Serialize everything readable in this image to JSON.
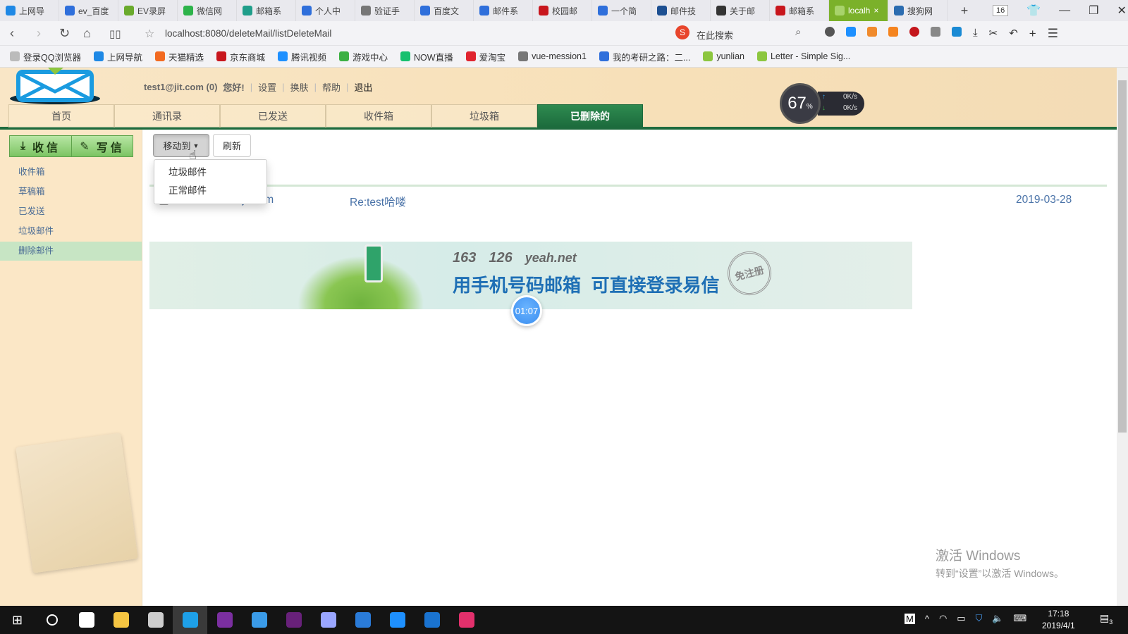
{
  "browser": {
    "tabs": [
      {
        "label": "上网导",
        "color": "#1e88e5"
      },
      {
        "label": "ev_百度",
        "color": "#2f6fdb"
      },
      {
        "label": "EV录屏",
        "color": "#6aaa2c"
      },
      {
        "label": "微信网",
        "color": "#2db34a"
      },
      {
        "label": "邮箱系",
        "color": "#1f9e8a"
      },
      {
        "label": "个人中",
        "color": "#2f6fdb"
      },
      {
        "label": "验证手",
        "color": "#777777"
      },
      {
        "label": "百度文",
        "color": "#2f6fdb"
      },
      {
        "label": "邮件系",
        "color": "#2f6fdb"
      },
      {
        "label": "校园邮",
        "color": "#c8161d"
      },
      {
        "label": "一个简",
        "color": "#2f6fdb"
      },
      {
        "label": "邮件技",
        "color": "#1d4f91"
      },
      {
        "label": "关于邮",
        "color": "#333333"
      },
      {
        "label": "邮箱系",
        "color": "#c8161d"
      },
      {
        "label": "localh",
        "color": "#a8d36b",
        "active": true
      },
      {
        "label": "搜狗网",
        "color": "#2b6cb0"
      }
    ],
    "new_tab": "+",
    "tab_count": "16",
    "url": "localhost:8080/deleteMail/listDeleteMail",
    "search_placeholder": "在此搜索",
    "bookmarks": [
      "登录QQ浏览器",
      "上网导航",
      "天猫精选",
      "京东商城",
      "腾讯视频",
      "游戏中心",
      "NOW直播",
      "爱淘宝",
      "vue-mession1",
      "我的考研之路：二...",
      "yunlian",
      "Letter - Simple Sig..."
    ]
  },
  "header": {
    "user": "test1@jit.com (0)",
    "greeting": "您好!",
    "links": [
      "设置",
      "换肤",
      "帮助",
      "退出"
    ],
    "nav": [
      "首页",
      "通讯录",
      "已发送",
      "收件箱",
      "垃圾箱",
      "已删除的"
    ],
    "active_nav": 5
  },
  "speed_widget": {
    "percent": "67",
    "unit": "%",
    "up": "0K/s",
    "down": "0K/s"
  },
  "sidebar": {
    "receive_button": "收信",
    "write_button": "写信",
    "items": [
      "收件箱",
      "草稿箱",
      "已发送",
      "垃圾邮件",
      "删除邮件"
    ],
    "active_item": 4
  },
  "toolbar": {
    "move_to": "移动到",
    "refresh": "刷新",
    "dropdown_options": [
      "垃圾邮件",
      "正常邮件"
    ]
  },
  "mails": [
    {
      "sender": "test2@jit.com",
      "subject": "Re:test哈喽",
      "date": "2019-03-28"
    }
  ],
  "banner": {
    "brands": [
      "163",
      "126",
      "yeah.net"
    ],
    "slogan": "用手机号码邮箱  可直接登录易信",
    "stamp": "免注册"
  },
  "timer": "01:07",
  "watermark": {
    "title": "激活 Windows",
    "subtitle": "转到“设置”以激活 Windows。"
  },
  "taskbar": {
    "time": "17:18",
    "date": "2019/4/1",
    "notifications": "3",
    "ime": "M"
  }
}
